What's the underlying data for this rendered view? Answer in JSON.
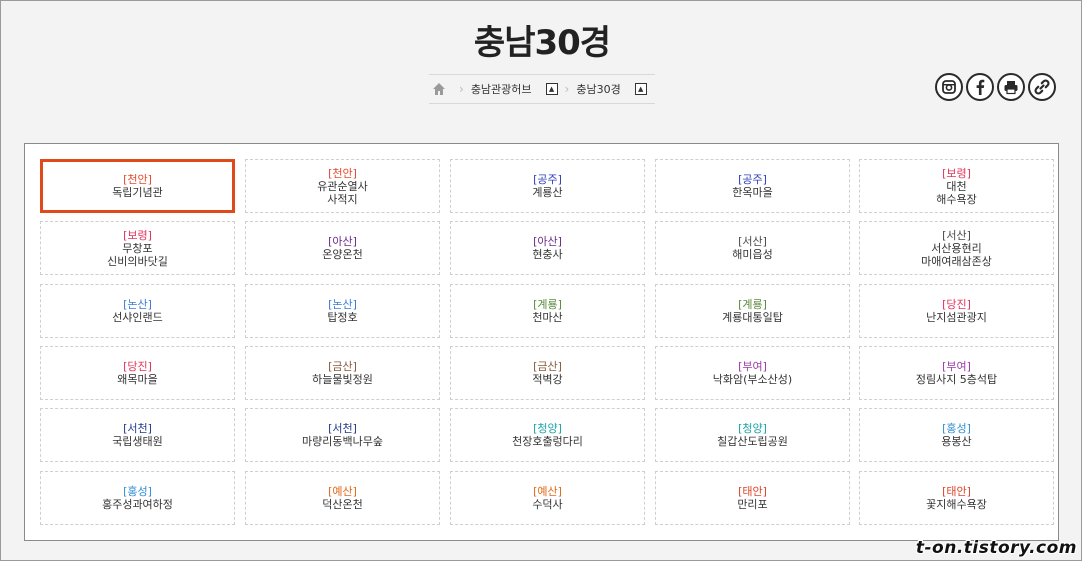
{
  "page": {
    "title": "충남30경"
  },
  "breadcrumb": {
    "items": [
      {
        "label": "충남관광허브",
        "toggle": "▲"
      },
      {
        "label": "충남30경",
        "toggle": "▲"
      }
    ]
  },
  "share": {
    "buttons": [
      "instagram-icon",
      "facebook-icon",
      "print-icon",
      "link-icon"
    ]
  },
  "regionColors": {
    "천안": "#e64a2e",
    "공주": "#2f3fbf",
    "보령": "#e0335a",
    "아산": "#6a2c8a",
    "서산": "#4a4a4a",
    "논산": "#3a7bd5",
    "계룡": "#5a8a3a",
    "당진": "#e0335a",
    "금산": "#8a5a3a",
    "부여": "#9a3aa8",
    "서천": "#1f3a8a",
    "청양": "#1aa5a5",
    "홍성": "#2f8fd5",
    "예산": "#e06a1a",
    "태안": "#d9452a"
  },
  "spots": [
    {
      "region": "[천안]",
      "key": "천안",
      "name": "독립기념관",
      "selected": true
    },
    {
      "region": "[천안]",
      "key": "천안",
      "name": "유관순열사\n사적지"
    },
    {
      "region": "[공주]",
      "key": "공주",
      "name": "계룡산"
    },
    {
      "region": "[공주]",
      "key": "공주",
      "name": "한옥마을"
    },
    {
      "region": "[보령]",
      "key": "보령",
      "name": "대천\n해수욕장"
    },
    {
      "region": "[보령]",
      "key": "보령",
      "name": "무창포\n신비의바닷길"
    },
    {
      "region": "[아산]",
      "key": "아산",
      "name": "온양온천"
    },
    {
      "region": "[아산]",
      "key": "아산",
      "name": "현충사"
    },
    {
      "region": "[서산]",
      "key": "서산",
      "name": "해미읍성"
    },
    {
      "region": "[서산]",
      "key": "서산",
      "name": "서산용현리\n마애여래삼존상"
    },
    {
      "region": "[논산]",
      "key": "논산",
      "name": "선샤인랜드"
    },
    {
      "region": "[논산]",
      "key": "논산",
      "name": "탑정호"
    },
    {
      "region": "[계룡]",
      "key": "계룡",
      "name": "천마산"
    },
    {
      "region": "[계룡]",
      "key": "계룡",
      "name": "계룡대통일탑"
    },
    {
      "region": "[당진]",
      "key": "당진",
      "name": "난지섬관광지"
    },
    {
      "region": "[당진]",
      "key": "당진",
      "name": "왜목마을"
    },
    {
      "region": "[금산]",
      "key": "금산",
      "name": "하늘물빛정원"
    },
    {
      "region": "[금산]",
      "key": "금산",
      "name": "적벽강"
    },
    {
      "region": "[부여]",
      "key": "부여",
      "name": "낙화암(부소산성)"
    },
    {
      "region": "[부여]",
      "key": "부여",
      "name": "정림사지 5층석탑"
    },
    {
      "region": "[서천]",
      "key": "서천",
      "name": "국립생태원"
    },
    {
      "region": "[서천]",
      "key": "서천",
      "name": "마량리동백나무숲"
    },
    {
      "region": "[청양]",
      "key": "청양",
      "name": "천장호출렁다리"
    },
    {
      "region": "[청양]",
      "key": "청양",
      "name": "칠갑산도립공원"
    },
    {
      "region": "[홍성]",
      "key": "홍성",
      "name": "용봉산"
    },
    {
      "region": "[홍성]",
      "key": "홍성",
      "name": "홍주성과여하정"
    },
    {
      "region": "[예산]",
      "key": "예산",
      "name": "덕산온천"
    },
    {
      "region": "[예산]",
      "key": "예산",
      "name": "수덕사"
    },
    {
      "region": "[태안]",
      "key": "태안",
      "name": "만리포"
    },
    {
      "region": "[태안]",
      "key": "태안",
      "name": "꽃지해수욕장"
    }
  ],
  "watermark": "t-on.tistory.com"
}
